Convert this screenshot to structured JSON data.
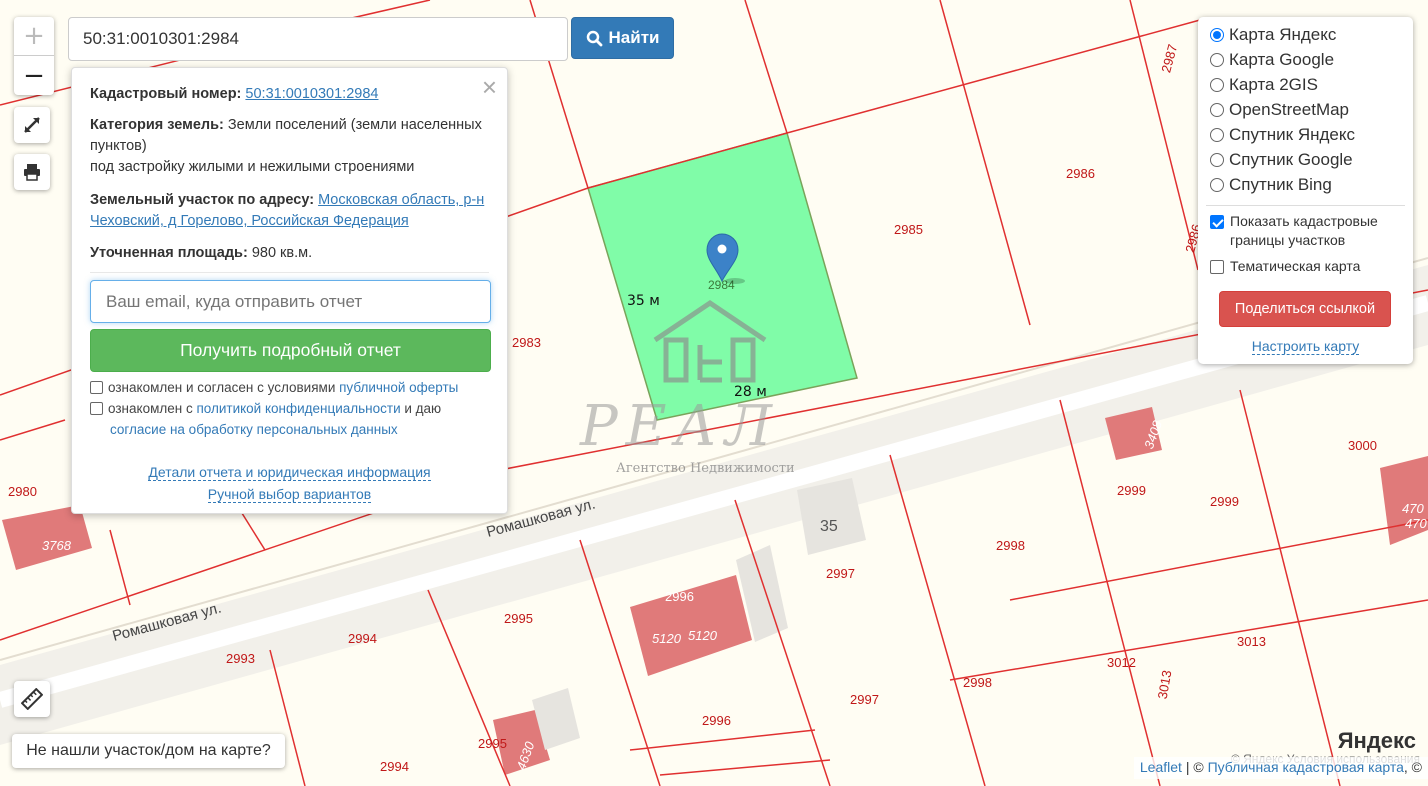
{
  "search": {
    "value": "50:31:0010301:2984",
    "button_label": "Найти"
  },
  "popup": {
    "cadastral_label": "Кадастровый номер:",
    "cadastral_value": "50:31:0010301:2984",
    "category_label": "Категория земель:",
    "category_value": "Земли поселений (земли населенных пунктов)",
    "category_use": "под застройку жилыми и нежилыми строениями",
    "address_label": "Земельный участок по адресу:",
    "address_value": "Московская область, р-н Чеховский, д Горелово, Российская Федерация",
    "area_label": "Уточненная площадь:",
    "area_value": "980 кв.м.",
    "email_placeholder": "Ваш email, куда отправить отчет",
    "report_button": "Получить подробный отчет",
    "consent1_text": "ознакомлен и согласен с условиями ",
    "consent1_link": "публичной оферты",
    "consent2_text": "ознакомлен с ",
    "consent2_link": "политикой конфиденциальности",
    "consent2_and": " и даю",
    "consent2_link2": "согласие на обработку персональных данных",
    "details_link": "Детали отчета и юридическая информация",
    "manual_link": "Ручной выбор вариантов",
    "close_icon": "×"
  },
  "layers": {
    "options": [
      "Карта Яндекс",
      "Карта Google",
      "Карта 2GIS",
      "OpenStreetMap",
      "Спутник Яндекс",
      "Спутник Google",
      "Спутник Bing"
    ],
    "selected": "Карта Яндекс",
    "show_borders": "Показать кадастровые границы участков",
    "thematic": "Тематическая карта",
    "share_button": "Поделиться ссылкой",
    "configure_link": "Настроить карту"
  },
  "zoom": {
    "in": "+",
    "out": "−"
  },
  "notfound_button": "Не нашли участок/дом на карте?",
  "attribution": {
    "leaflet": "Leaflet",
    "sep": " | © ",
    "pkk": "Публичная кадастровая карта",
    "tail": ", ©",
    "yandex_copy": "© Яндекс  Условия использования",
    "yandex_logo": "Яндекс"
  },
  "map": {
    "parcel_selected": "2984",
    "dim_side": "35 м",
    "dim_bottom": "28 м",
    "watermark": "РЕАЛ",
    "watermark_sub": "Агентство Недвижимости",
    "streets": [
      "Ромашковая ул.",
      "Ромашковая ул."
    ],
    "labels": [
      {
        "t": "2987"
      },
      {
        "t": "2986"
      },
      {
        "t": "2986"
      },
      {
        "t": "2985"
      },
      {
        "t": "2983"
      },
      {
        "t": "2980"
      },
      {
        "t": "3768"
      },
      {
        "t": "3408"
      },
      {
        "t": "2999"
      },
      {
        "t": "2999"
      },
      {
        "t": "3000"
      },
      {
        "t": "470"
      },
      {
        "t": "470"
      },
      {
        "t": "35"
      },
      {
        "t": "2998"
      },
      {
        "t": "2997"
      },
      {
        "t": "2996"
      },
      {
        "t": "5120"
      },
      {
        "t": "5120"
      },
      {
        "t": "2995"
      },
      {
        "t": "2994"
      },
      {
        "t": "2993"
      },
      {
        "t": "2997"
      },
      {
        "t": "2998"
      },
      {
        "t": "3012"
      },
      {
        "t": "3013"
      },
      {
        "t": "3013"
      },
      {
        "t": "2996"
      },
      {
        "t": "2995"
      },
      {
        "t": "4630"
      },
      {
        "t": "2994"
      }
    ]
  }
}
